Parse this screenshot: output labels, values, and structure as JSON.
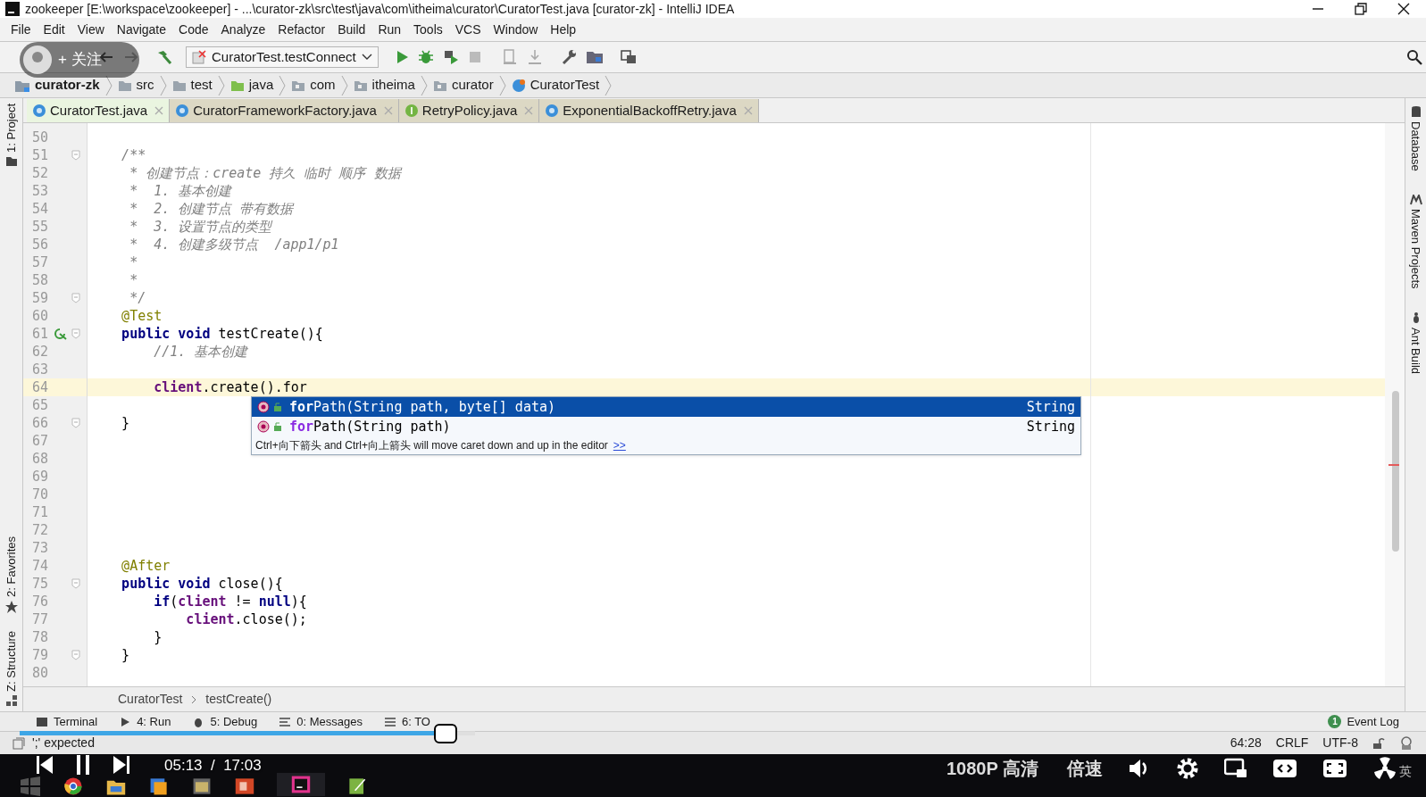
{
  "window": {
    "title": "zookeeper [E:\\workspace\\zookeeper] - ...\\curator-zk\\src\\test\\java\\com\\itheima\\curator\\CuratorTest.java [curator-zk] - IntelliJ IDEA"
  },
  "menu": [
    "File",
    "Edit",
    "View",
    "Navigate",
    "Code",
    "Analyze",
    "Refactor",
    "Build",
    "Run",
    "Tools",
    "VCS",
    "Window",
    "Help"
  ],
  "toolbar": {
    "run_config": "CuratorTest.testConnect"
  },
  "breadcrumb": [
    {
      "label": "curator-zk",
      "kind": "module"
    },
    {
      "label": "src",
      "kind": "folder"
    },
    {
      "label": "test",
      "kind": "folder"
    },
    {
      "label": "java",
      "kind": "source"
    },
    {
      "label": "com",
      "kind": "package"
    },
    {
      "label": "itheima",
      "kind": "package"
    },
    {
      "label": "curator",
      "kind": "package"
    },
    {
      "label": "CuratorTest",
      "kind": "class"
    }
  ],
  "tabs": [
    {
      "label": "CuratorTest.java",
      "kind": "class",
      "selected": true
    },
    {
      "label": "CuratorFrameworkFactory.java",
      "kind": "class",
      "selected": false
    },
    {
      "label": "RetryPolicy.java",
      "kind": "interface",
      "selected": false
    },
    {
      "label": "ExponentialBackoffRetry.java",
      "kind": "class",
      "selected": false
    }
  ],
  "left_tools": [
    "1: Project",
    "2: Favorites",
    "Z: Structure"
  ],
  "right_tools": [
    "Database",
    "Maven Projects",
    "Ant Build"
  ],
  "editor": {
    "lines": [
      {
        "number": "50",
        "fold": false,
        "current": false
      },
      {
        "number": "51",
        "fold": true,
        "current": false,
        "segments": [
          {
            "text": "    /**",
            "kind": "comment"
          }
        ]
      },
      {
        "number": "52",
        "fold": false,
        "current": false,
        "segments": [
          {
            "text": "     * 创建节点：create 持久 临时 顺序 数据",
            "kind": "comment"
          }
        ]
      },
      {
        "number": "53",
        "fold": false,
        "current": false,
        "segments": [
          {
            "text": "     *  1. 基本创建",
            "kind": "comment"
          }
        ]
      },
      {
        "number": "54",
        "fold": false,
        "current": false,
        "segments": [
          {
            "text": "     *  2. 创建节点 带有数据",
            "kind": "comment"
          }
        ]
      },
      {
        "number": "55",
        "fold": false,
        "current": false,
        "segments": [
          {
            "text": "     *  3. 设置节点的类型",
            "kind": "comment"
          }
        ]
      },
      {
        "number": "56",
        "fold": false,
        "current": false,
        "segments": [
          {
            "text": "     *  4. 创建多级节点  /app1/p1",
            "kind": "comment"
          }
        ]
      },
      {
        "number": "57",
        "fold": false,
        "current": false,
        "segments": [
          {
            "text": "     *",
            "kind": "comment"
          }
        ]
      },
      {
        "number": "58",
        "fold": false,
        "current": false,
        "segments": [
          {
            "text": "     *",
            "kind": "comment"
          }
        ]
      },
      {
        "number": "59",
        "fold": true,
        "current": false,
        "segments": [
          {
            "text": "     */",
            "kind": "comment"
          }
        ]
      },
      {
        "number": "60",
        "fold": false,
        "current": false,
        "segments": [
          {
            "text": "    @Test",
            "kind": "annotation"
          }
        ]
      },
      {
        "number": "61",
        "fold": true,
        "current": false,
        "run_marker": true,
        "segments": [
          {
            "text": "    public void",
            "kind": "keyword"
          },
          {
            "text": " testCreate(){",
            "kind": "plain"
          }
        ]
      },
      {
        "number": "62",
        "fold": false,
        "current": false,
        "segments": [
          {
            "text": "        //1. 基本创建",
            "kind": "comment"
          }
        ]
      },
      {
        "number": "63",
        "fold": false,
        "current": false
      },
      {
        "number": "64",
        "fold": false,
        "current": true,
        "segments": [
          {
            "text": "        client",
            "kind": "field"
          },
          {
            "text": ".create().for",
            "kind": "plain"
          }
        ]
      },
      {
        "number": "65",
        "fold": false,
        "current": false
      },
      {
        "number": "66",
        "fold": true,
        "current": false,
        "segments": [
          {
            "text": "    }",
            "kind": "plain"
          }
        ]
      },
      {
        "number": "67",
        "fold": false,
        "current": false
      },
      {
        "number": "68",
        "fold": false,
        "current": false
      },
      {
        "number": "69",
        "fold": false,
        "current": false
      },
      {
        "number": "70",
        "fold": false,
        "current": false
      },
      {
        "number": "71",
        "fold": false,
        "current": false
      },
      {
        "number": "72",
        "fold": false,
        "current": false
      },
      {
        "number": "73",
        "fold": false,
        "current": false
      },
      {
        "number": "74",
        "fold": false,
        "current": false,
        "segments": [
          {
            "text": "    @After",
            "kind": "annotation"
          }
        ]
      },
      {
        "number": "75",
        "fold": true,
        "current": false,
        "segments": [
          {
            "text": "    public void",
            "kind": "keyword"
          },
          {
            "text": " close(){",
            "kind": "plain"
          }
        ]
      },
      {
        "number": "76",
        "fold": false,
        "current": false,
        "segments": [
          {
            "text": "        if",
            "kind": "keyword"
          },
          {
            "text": "(",
            "kind": "plain"
          },
          {
            "text": "client",
            "kind": "field"
          },
          {
            "text": " != ",
            "kind": "plain"
          },
          {
            "text": "null",
            "kind": "keyword"
          },
          {
            "text": "){",
            "kind": "plain"
          }
        ]
      },
      {
        "number": "77",
        "fold": false,
        "current": false,
        "segments": [
          {
            "text": "            client",
            "kind": "field"
          },
          {
            "text": ".close();",
            "kind": "plain"
          }
        ]
      },
      {
        "number": "78",
        "fold": false,
        "current": false,
        "segments": [
          {
            "text": "        }",
            "kind": "plain"
          }
        ]
      },
      {
        "number": "79",
        "fold": true,
        "current": false,
        "segments": [
          {
            "text": "    }",
            "kind": "plain"
          }
        ]
      },
      {
        "number": "80",
        "fold": false,
        "current": false
      }
    ]
  },
  "completion": {
    "items": [
      {
        "match": "for",
        "rest": "Path(String path, byte[] data)",
        "type": "String",
        "selected": true
      },
      {
        "match": "for",
        "rest": "Path(String path)",
        "type": "String",
        "selected": false
      }
    ],
    "hint": "Ctrl+向下箭头 and Ctrl+向上箭头 will move caret down and up in the editor",
    "hint_link": ">>"
  },
  "nav_breadcrumb": [
    "CuratorTest",
    "testCreate()"
  ],
  "tool_windows": [
    "Terminal",
    "4: Run",
    "5: Debug",
    "0: Messages",
    "6: TO"
  ],
  "event_log": {
    "label": "Event Log",
    "count": "1"
  },
  "status_bar": {
    "message": "';' expected",
    "position": "64:28",
    "line_separator": "CRLF",
    "encoding": "UTF-8"
  },
  "player": {
    "follow": "+ 关注",
    "time": "05:13  /  17:03",
    "quality": "1080P 高清",
    "speed": "倍速",
    "progress": {
      "level": 0.935
    },
    "ime": "英"
  }
}
